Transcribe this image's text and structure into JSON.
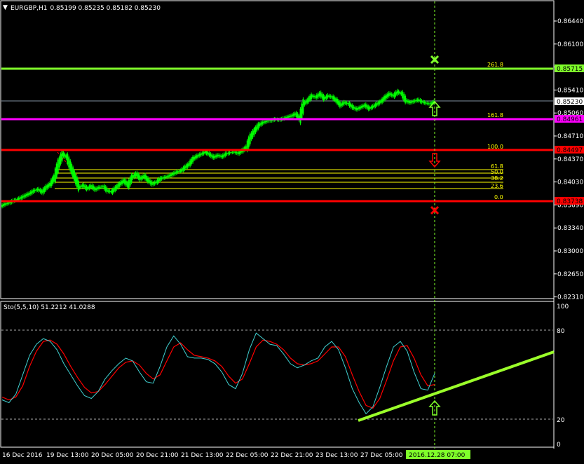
{
  "header": {
    "symbol": "EURGBP,H1",
    "ohlc": "0.85199 0.85235 0.85182 0.85230"
  },
  "colors": {
    "bg": "#000000",
    "grid": "#ffffff",
    "candle": "#00ff00",
    "fib": "#ffff00",
    "green_line": "#7fff2a",
    "magenta_line": "#ff00ff",
    "red_line": "#ff0000",
    "stoch_main": "#40d0d0",
    "stoch_signal": "#ff0000",
    "trend": "#9bff2a"
  },
  "price_axis": {
    "ticks": [
      "0.86440",
      "0.86100",
      "0.85750",
      "0.85410",
      "0.85060",
      "0.84710",
      "0.84370",
      "0.84030",
      "0.83690",
      "0.83340",
      "0.83000",
      "0.82650",
      "0.82310"
    ],
    "current": "0.85230"
  },
  "levels": [
    {
      "label": "0.85715",
      "fib": "261.8",
      "kind": "green"
    },
    {
      "label": "0.84961",
      "fib": "161.8",
      "kind": "magenta"
    },
    {
      "label": "0.84497",
      "fib": "100.0",
      "kind": "red"
    },
    {
      "label": "0.83738",
      "fib": "0.0",
      "kind": "red"
    }
  ],
  "fib_small": [
    "61.8",
    "50.0",
    "38.2",
    "23.6"
  ],
  "indicator": {
    "title": "Sto(5,5,10) 51.2212 41.0288",
    "axis": [
      "100",
      "80",
      "20",
      "0"
    ]
  },
  "time_axis": {
    "labels": [
      "16 Dec 2016",
      "19 Dec 13:00",
      "20 Dec 05:00",
      "20 Dec 21:00",
      "21 Dec 13:00",
      "22 Dec 05:00",
      "22 Dec 21:00",
      "23 Dec 13:00",
      "27 Dec 05:00"
    ],
    "cursor": "2016.12.28 07:00"
  },
  "chart_data": {
    "type": "candlestick",
    "close_series": [
      0.837,
      0.8372,
      0.8375,
      0.8377,
      0.838,
      0.8383,
      0.8386,
      0.839,
      0.8392,
      0.8388,
      0.8395,
      0.84,
      0.841,
      0.843,
      0.8445,
      0.844,
      0.8425,
      0.841,
      0.8395,
      0.8398,
      0.8393,
      0.8397,
      0.8392,
      0.8395,
      0.8396,
      0.839,
      0.8388,
      0.8394,
      0.84,
      0.8405,
      0.8398,
      0.841,
      0.8415,
      0.8408,
      0.8412,
      0.8405,
      0.84,
      0.8403,
      0.8408,
      0.841,
      0.8412,
      0.8415,
      0.8418,
      0.842,
      0.8425,
      0.843,
      0.8438,
      0.8442,
      0.8445,
      0.8448,
      0.8444,
      0.844,
      0.8443,
      0.8441,
      0.8445,
      0.8447,
      0.8448,
      0.8446,
      0.845,
      0.8455,
      0.847,
      0.848,
      0.8488,
      0.8492,
      0.8494,
      0.8495,
      0.8497,
      0.8496,
      0.8498,
      0.85,
      0.8502,
      0.8505,
      0.8498,
      0.852,
      0.8525,
      0.8532,
      0.853,
      0.8535,
      0.8528,
      0.8532,
      0.853,
      0.8525,
      0.8518,
      0.8522,
      0.852,
      0.8515,
      0.8512,
      0.8515,
      0.8518,
      0.8513,
      0.8516,
      0.852,
      0.8524,
      0.853,
      0.8535,
      0.8532,
      0.8538,
      0.8535,
      0.8525,
      0.8522,
      0.8524,
      0.8526,
      0.8523,
      0.8521,
      0.852,
      0.8523
    ],
    "stoch_main": [
      32,
      30,
      36,
      50,
      64,
      72,
      76,
      74,
      68,
      58,
      50,
      42,
      35,
      33,
      38,
      47,
      53,
      58,
      62,
      60,
      52,
      45,
      44,
      56,
      70,
      78,
      72,
      63,
      62,
      62,
      61,
      58,
      52,
      43,
      40,
      51,
      68,
      80,
      76,
      72,
      71,
      65,
      58,
      55,
      57,
      60,
      62,
      70,
      74,
      68,
      55,
      40,
      30,
      22,
      27,
      41,
      56,
      70,
      74,
      67,
      52,
      40,
      39,
      51
    ],
    "stoch_signal": [
      34,
      32,
      34,
      42,
      56,
      67,
      74,
      75,
      72,
      65,
      56,
      48,
      41,
      37,
      38,
      43,
      49,
      55,
      59,
      60,
      57,
      51,
      47,
      50,
      60,
      70,
      73,
      68,
      64,
      63,
      62,
      60,
      56,
      49,
      44,
      47,
      58,
      70,
      75,
      74,
      72,
      68,
      62,
      58,
      57,
      58,
      60,
      65,
      70,
      70,
      63,
      50,
      38,
      28,
      26,
      33,
      46,
      60,
      70,
      71,
      62,
      50,
      42,
      43
    ],
    "stoch_levels": [
      80,
      20
    ],
    "ylim": [
      0.8231,
      0.8647
    ]
  }
}
